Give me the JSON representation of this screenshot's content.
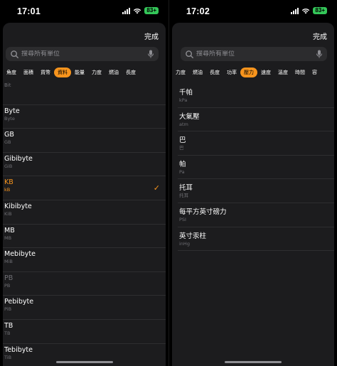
{
  "left": {
    "time": "17:01",
    "battery": "83+",
    "done_label": "完成",
    "search_placeholder": "搜尋所有單位",
    "categories": [
      "角度",
      "面積",
      "貨幣",
      "資料",
      "能量",
      "力度",
      "燃油",
      "長度"
    ],
    "active_category": "資料",
    "units": [
      {
        "name": "",
        "abbr": "Bit"
      },
      {
        "name": "Byte",
        "abbr": "Byte"
      },
      {
        "name": "GB",
        "abbr": "GB"
      },
      {
        "name": "Gibibyte",
        "abbr": "GiB"
      },
      {
        "name": "KB",
        "abbr": "kB"
      },
      {
        "name": "Kibibyte",
        "abbr": "KiB"
      },
      {
        "name": "MB",
        "abbr": "MB"
      },
      {
        "name": "Mebibyte",
        "abbr": "MiB"
      },
      {
        "name": "PB",
        "abbr": "PB"
      },
      {
        "name": "Pebibyte",
        "abbr": "PiB"
      },
      {
        "name": "TB",
        "abbr": "TB"
      },
      {
        "name": "Tebibyte",
        "abbr": "TiB"
      }
    ],
    "selected_unit": "KB",
    "accent_color": "#f7941d"
  },
  "right": {
    "time": "17:02",
    "battery": "83+",
    "done_label": "完成",
    "search_placeholder": "搜尋所有單位",
    "categories": [
      "力度",
      "燃油",
      "長度",
      "功率",
      "壓力",
      "速度",
      "溫度",
      "時間",
      "容"
    ],
    "active_category": "壓力",
    "units": [
      {
        "name": "千帕",
        "abbr": "kPa"
      },
      {
        "name": "大氣壓",
        "abbr": "atm"
      },
      {
        "name": "巴",
        "abbr": "巴"
      },
      {
        "name": "帕",
        "abbr": "Pa"
      },
      {
        "name": "托耳",
        "abbr": "托耳"
      },
      {
        "name": "每平方英寸磅力",
        "abbr": "PSI"
      },
      {
        "name": "英寸汞柱",
        "abbr": "inHg"
      }
    ]
  }
}
